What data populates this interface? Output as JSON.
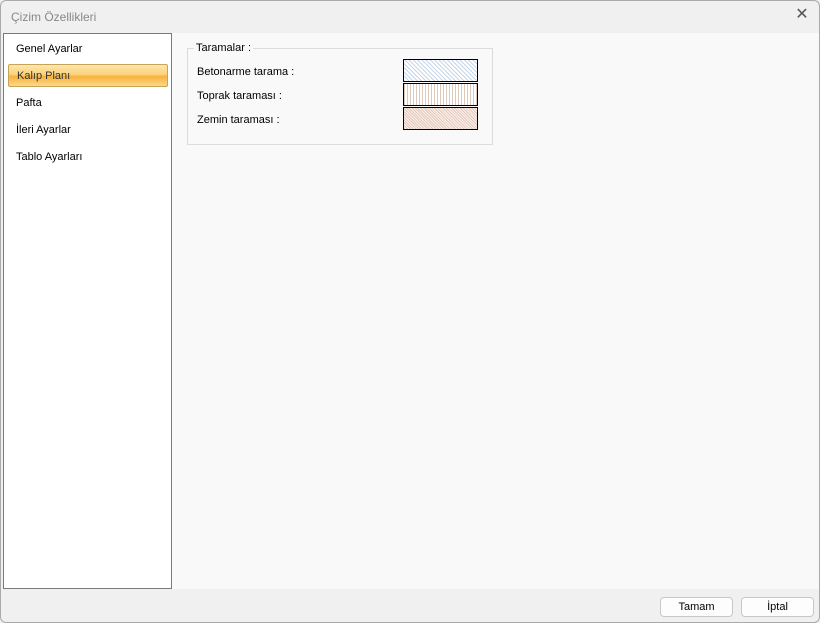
{
  "window": {
    "title": "Çizim Özellikleri",
    "close_icon": "close-icon"
  },
  "sidebar": {
    "items": [
      {
        "label": "Genel Ayarlar",
        "selected": false
      },
      {
        "label": "Kalıp Planı",
        "selected": true
      },
      {
        "label": "Pafta",
        "selected": false
      },
      {
        "label": "İleri Ayarlar",
        "selected": false
      },
      {
        "label": "Tablo Ayarları",
        "selected": false
      }
    ]
  },
  "main": {
    "group_title": "Taramalar :",
    "rows": [
      {
        "label": "Betonarme tarama :"
      },
      {
        "label": "Toprak taraması :"
      },
      {
        "label": "Zemin taraması :"
      }
    ]
  },
  "footer": {
    "ok_label": "Tamam",
    "cancel_label": "İptal"
  }
}
